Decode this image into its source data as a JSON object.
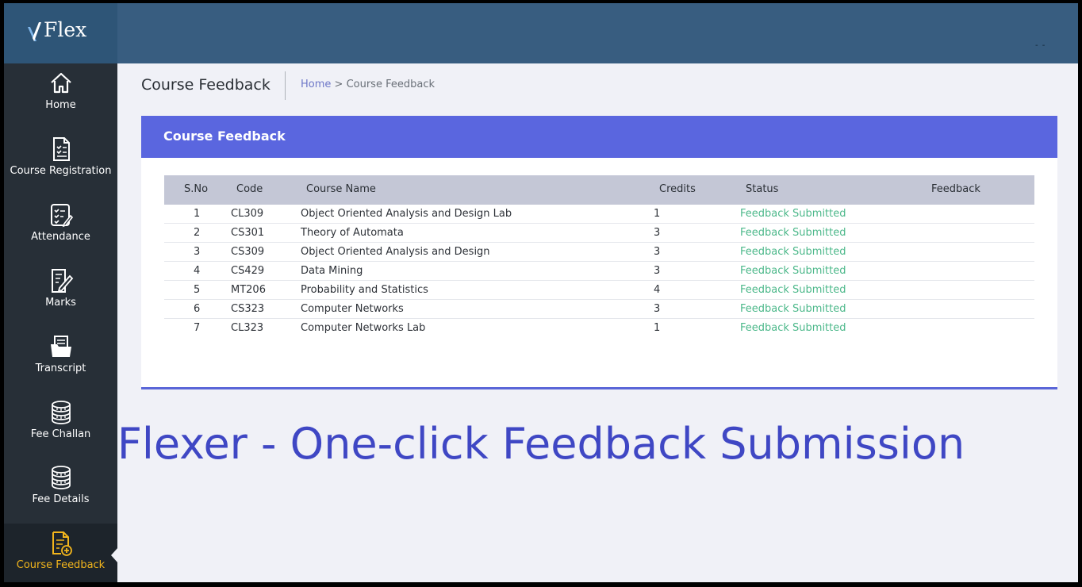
{
  "app": {
    "logo_text": "Flex",
    "top_indicator": "- -"
  },
  "sidebar": {
    "items": [
      {
        "label": "Home",
        "icon": "home-icon"
      },
      {
        "label": "Course Registration",
        "icon": "clipboard-list-icon"
      },
      {
        "label": "Attendance",
        "icon": "checklist-icon"
      },
      {
        "label": "Marks",
        "icon": "edit-document-icon"
      },
      {
        "label": "Transcript",
        "icon": "folder-document-icon"
      },
      {
        "label": "Fee Challan",
        "icon": "coins-stack-icon"
      },
      {
        "label": "Fee Details",
        "icon": "coins-stack-icon"
      },
      {
        "label": "Course Feedback",
        "icon": "feedback-document-icon",
        "active": true
      }
    ]
  },
  "header": {
    "title": "Course Feedback",
    "breadcrumb": {
      "home": "Home",
      "separator": " > ",
      "current": "Course Feedback"
    }
  },
  "card": {
    "title": "Course Feedback",
    "columns": [
      "S.No",
      "Code",
      "Course Name",
      "Credits",
      "Status",
      "Feedback"
    ],
    "rows": [
      {
        "sno": "1",
        "code": "CL309",
        "name": "Object Oriented Analysis and Design Lab",
        "credits": "1",
        "status": "Feedback Submitted"
      },
      {
        "sno": "2",
        "code": "CS301",
        "name": "Theory of Automata",
        "credits": "3",
        "status": "Feedback Submitted"
      },
      {
        "sno": "3",
        "code": "CS309",
        "name": "Object Oriented Analysis and Design",
        "credits": "3",
        "status": "Feedback Submitted"
      },
      {
        "sno": "4",
        "code": "CS429",
        "name": "Data Mining",
        "credits": "3",
        "status": "Feedback Submitted"
      },
      {
        "sno": "5",
        "code": "MT206",
        "name": "Probability and Statistics",
        "credits": "4",
        "status": "Feedback Submitted"
      },
      {
        "sno": "6",
        "code": "CS323",
        "name": "Computer Networks",
        "credits": "3",
        "status": "Feedback Submitted"
      },
      {
        "sno": "7",
        "code": "CL323",
        "name": "Computer Networks Lab",
        "credits": "1",
        "status": "Feedback Submitted"
      }
    ]
  },
  "banner": {
    "text": "Flexer - One-click Feedback Submission"
  },
  "colors": {
    "topbar": "#385d80",
    "sidebar": "#272f37",
    "active_nav": "#f2b51c",
    "card_header": "#5a66df",
    "status_text": "#4cb88a",
    "banner_text": "#3f47c4"
  }
}
